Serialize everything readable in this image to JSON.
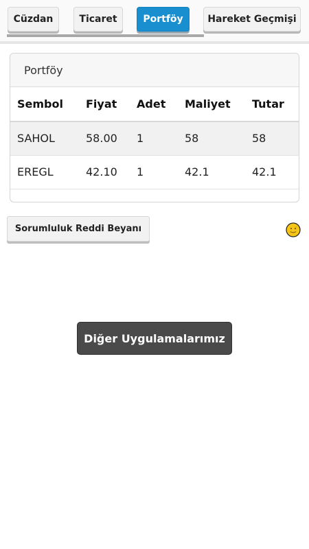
{
  "tabs": [
    {
      "label": "Cüzdan",
      "active": false
    },
    {
      "label": "Ticaret",
      "active": false
    },
    {
      "label": "Portföy",
      "active": true
    },
    {
      "label": "Hareket Geçmişi",
      "active": false
    }
  ],
  "portfolio": {
    "title": "Portföy",
    "columns": [
      "Sembol",
      "Fiyat",
      "Adet",
      "Maliyet",
      "Tutar"
    ],
    "rows": [
      [
        "SAHOL",
        "58.00",
        "1",
        "58",
        "58"
      ],
      [
        "EREGL",
        "42.10",
        "1",
        "42.1",
        "42.1"
      ]
    ]
  },
  "disclaimer_label": "Sorumluluk Reddi Beyanı",
  "status_icon": "smiley-face-icon",
  "other_apps_label": "Diğer Uygulamalarımız",
  "colors": {
    "accent": "#1a8fd0",
    "dark_button": "#4a4a4a"
  }
}
